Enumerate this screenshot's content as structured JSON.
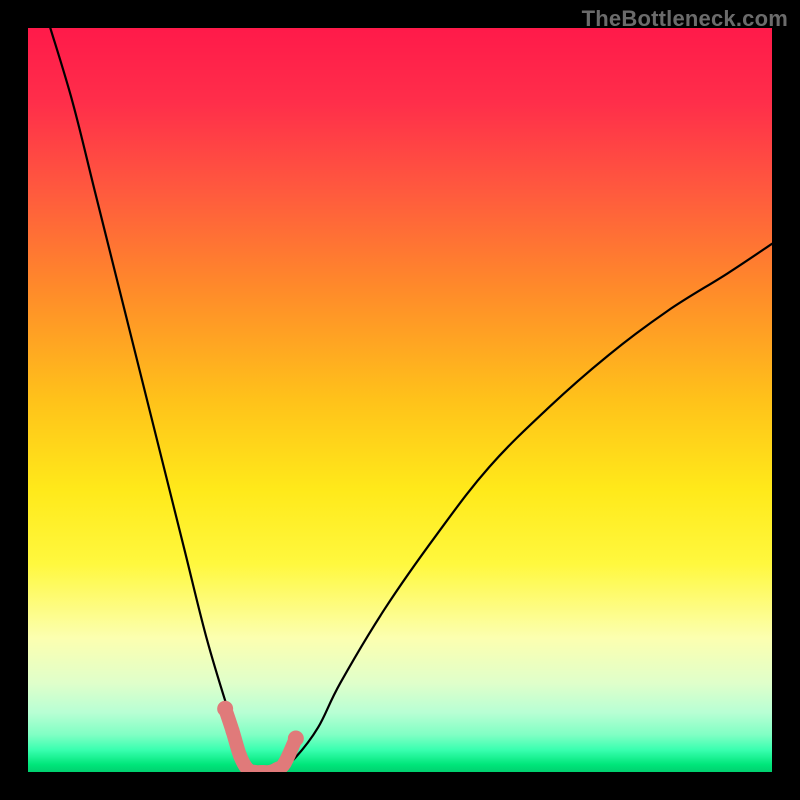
{
  "watermark": {
    "text": "TheBottleneck.com"
  },
  "colors": {
    "frame": "#000000",
    "curve_stroke": "#000000",
    "marker_line": "#e07a7a",
    "marker_fill": "#e07a7a"
  },
  "chart_data": {
    "type": "line",
    "title": "",
    "xlabel": "",
    "ylabel": "",
    "xlim": [
      0,
      100
    ],
    "ylim": [
      0,
      100
    ],
    "grid": false,
    "legend": false,
    "series": [
      {
        "name": "bottleneck-curve",
        "x": [
          3,
          6,
          9,
          12,
          15,
          18,
          21,
          24,
          27,
          29,
          30,
          31,
          32.5,
          34,
          36,
          39,
          42,
          48,
          55,
          62,
          70,
          78,
          86,
          94,
          100
        ],
        "y": [
          100,
          90,
          78,
          66,
          54,
          42,
          30,
          18,
          8,
          2,
          0,
          0,
          0,
          0.5,
          2,
          6,
          12,
          22,
          32,
          41,
          49,
          56,
          62,
          67,
          71
        ]
      }
    ],
    "markers": {
      "points_x": [
        26.5,
        27.5,
        28.5,
        29.5,
        30.5,
        31.5,
        32.5,
        33.5,
        34.5,
        36.0
      ],
      "points_y": [
        8.5,
        5.5,
        2.2,
        0.4,
        0,
        0,
        0,
        0.4,
        1.2,
        4.5
      ]
    }
  }
}
